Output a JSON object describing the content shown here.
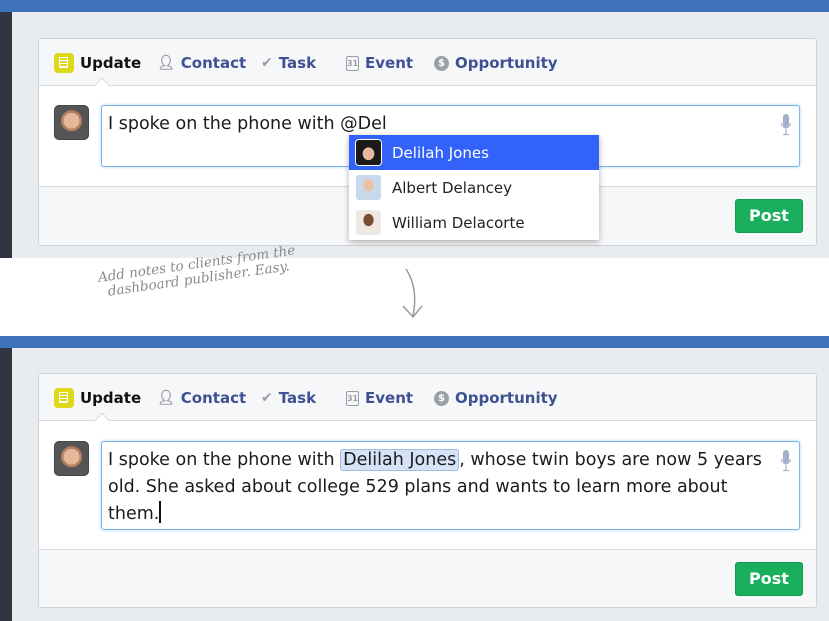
{
  "tabs": [
    {
      "label": "Update",
      "icon": "update-note-icon",
      "active": true
    },
    {
      "label": "Contact",
      "icon": "person-icon"
    },
    {
      "label": "Task",
      "icon": "checkmark-icon"
    },
    {
      "label": "Event",
      "icon": "calendar-icon",
      "icon_text": "31"
    },
    {
      "label": "Opportunity",
      "icon": "dollar-coin-icon"
    }
  ],
  "before": {
    "text": "I spoke on the phone with @Del",
    "suggestions": [
      {
        "name": "Delilah Jones",
        "selected": true
      },
      {
        "name": "Albert Delancey"
      },
      {
        "name": "William Delacorte"
      }
    ]
  },
  "caption": {
    "line1": "Add notes to clients from the",
    "line2": "dashboard publisher. Easy."
  },
  "after": {
    "text_before": "I spoke on the phone with ",
    "mention": "Delilah Jones",
    "text_after": ", whose twin boys are now 5 years old. She asked about college 529 plans and wants to learn more about them."
  },
  "post_label": "Post",
  "colors": {
    "accent_blue": "#3d72bb",
    "post_green": "#1aaf5d",
    "dropdown_highlight": "#3262f9",
    "tab_link": "#3e5193",
    "update_yellow": "#dfd81a"
  }
}
